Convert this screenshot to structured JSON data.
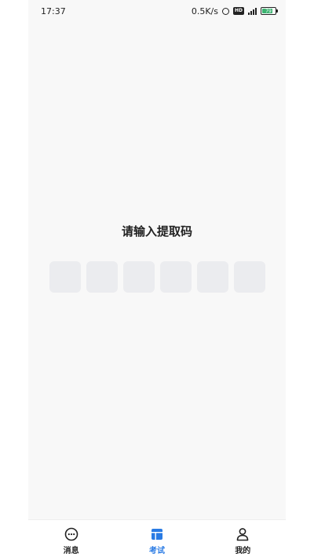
{
  "status_bar": {
    "time": "17:37",
    "network_speed": "0.5K/s",
    "battery_level": "79",
    "battery_fraction": 0.79
  },
  "main": {
    "prompt": "请输入提取码",
    "code_length": 6
  },
  "tab_bar": {
    "tabs": [
      {
        "label": "消息",
        "icon": "chat-bubble-icon",
        "active": false
      },
      {
        "label": "考试",
        "icon": "exam-board-icon",
        "active": true
      },
      {
        "label": "我的",
        "icon": "person-icon",
        "active": false
      }
    ]
  },
  "colors": {
    "accent": "#2a7be4",
    "code_box": "#ebecef",
    "background": "#f8f8f8"
  }
}
